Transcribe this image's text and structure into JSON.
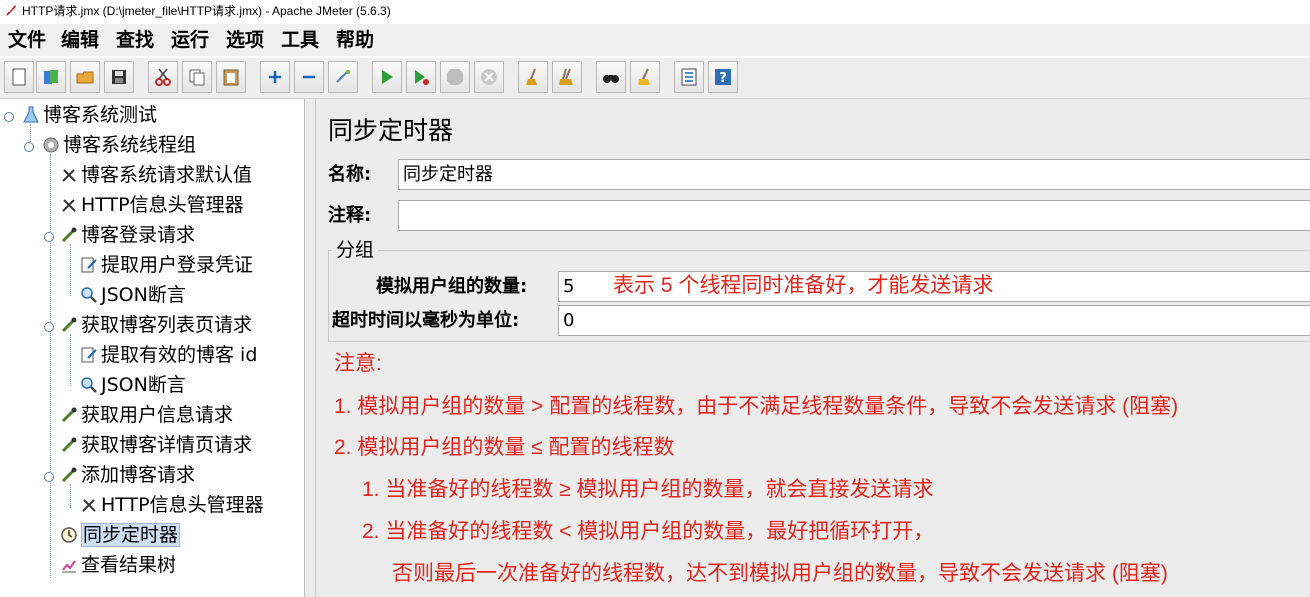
{
  "window": {
    "title": "HTTP请求.jmx (D:\\jmeter_file\\HTTP请求.jmx) - Apache JMeter (5.6.3)"
  },
  "menu": [
    "文件",
    "编辑",
    "查找",
    "运行",
    "选项",
    "工具",
    "帮助"
  ],
  "toolbar": [
    {
      "name": "new-icon"
    },
    {
      "name": "templates-icon"
    },
    {
      "name": "open-icon"
    },
    {
      "name": "save-icon"
    },
    {
      "name": "cut-icon"
    },
    {
      "name": "copy-icon"
    },
    {
      "name": "paste-icon"
    },
    {
      "name": "expand-icon"
    },
    {
      "name": "collapse-icon"
    },
    {
      "name": "toggle-icon"
    },
    {
      "name": "start-icon"
    },
    {
      "name": "start-no-pause-icon"
    },
    {
      "name": "stop-icon"
    },
    {
      "name": "shutdown-icon"
    },
    {
      "name": "clear-icon"
    },
    {
      "name": "clear-all-icon"
    },
    {
      "name": "search-icon"
    },
    {
      "name": "reset-search-icon"
    },
    {
      "name": "function-helper-icon"
    },
    {
      "name": "help-icon"
    }
  ],
  "tree": [
    {
      "label": "博客系统测试",
      "icon": "flask-icon"
    },
    {
      "label": "博客系统线程组",
      "icon": "gear-icon"
    },
    {
      "label": "博客系统请求默认值",
      "icon": "wrench-icon"
    },
    {
      "label": "HTTP信息头管理器",
      "icon": "wrench-icon"
    },
    {
      "label": "博客登录请求",
      "icon": "pipette-icon"
    },
    {
      "label": "提取用户登录凭证",
      "icon": "extractor-icon"
    },
    {
      "label": "JSON断言",
      "icon": "magnifier-icon"
    },
    {
      "label": "获取博客列表页请求",
      "icon": "pipette-icon"
    },
    {
      "label": "提取有效的博客 id",
      "icon": "extractor-icon"
    },
    {
      "label": "JSON断言",
      "icon": "magnifier-icon"
    },
    {
      "label": "获取用户信息请求",
      "icon": "pipette-icon"
    },
    {
      "label": "获取博客详情页请求",
      "icon": "pipette-icon"
    },
    {
      "label": "添加博客请求",
      "icon": "pipette-icon"
    },
    {
      "label": "HTTP信息头管理器",
      "icon": "wrench-icon"
    },
    {
      "label": "同步定时器",
      "icon": "timer-icon"
    },
    {
      "label": "查看结果树",
      "icon": "chart-icon"
    }
  ],
  "panel": {
    "title": "同步定时器",
    "name_label": "名称:",
    "name_value": "同步定时器",
    "comment_label": "注释:",
    "comment_value": "",
    "group_title": "分组",
    "num_users_label": "模拟用户组的数量:",
    "num_users_value": "5",
    "timeout_label": "超时时间以毫秒为单位:",
    "timeout_value": "0"
  },
  "annotations": {
    "inline_note": "表示 5 个线程同时准备好，才能发送请求",
    "note_title": "注意:",
    "line1": "1. 模拟用户组的数量 > 配置的线程数，由于不满足线程数量条件，导致不会发送请求 (阻塞)",
    "line2": "2. 模拟用户组的数量 ≤ 配置的线程数",
    "line2_1": "1. 当准备好的线程数 ≥ 模拟用户组的数量，就会直接发送请求",
    "line2_2": "2. 当准备好的线程数 < 模拟用户组的数量，最好把循环打开，",
    "line2_2b": "否则最后一次准备好的线程数，达不到模拟用户组的数量，导致不会发送请求 (阻塞)"
  },
  "colors": {
    "annotation": "#e0261d",
    "selection": "#cfe0f5"
  }
}
